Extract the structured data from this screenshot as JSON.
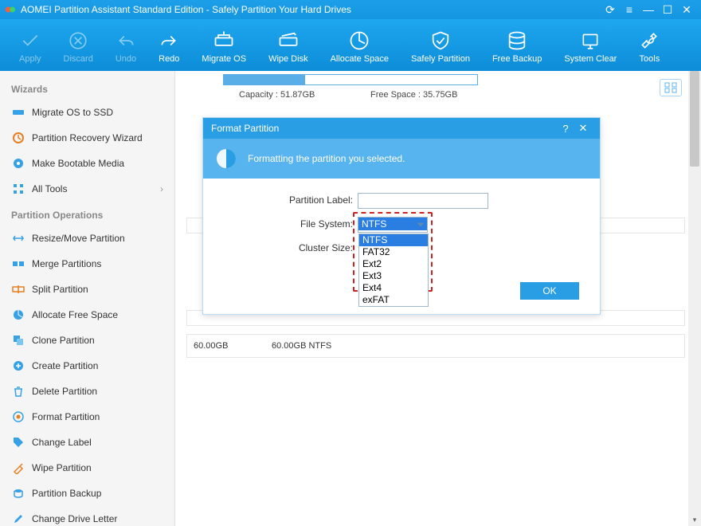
{
  "window": {
    "title": "AOMEI Partition Assistant Standard Edition - Safely Partition Your Hard Drives"
  },
  "toolbar": [
    {
      "label": "Apply",
      "disabled": true
    },
    {
      "label": "Discard",
      "disabled": true
    },
    {
      "label": "Undo",
      "disabled": true
    },
    {
      "label": "Redo"
    },
    {
      "label": "Migrate OS"
    },
    {
      "label": "Wipe Disk"
    },
    {
      "label": "Allocate Space"
    },
    {
      "label": "Safely Partition"
    },
    {
      "label": "Free Backup"
    },
    {
      "label": "System Clear"
    },
    {
      "label": "Tools"
    }
  ],
  "sidebar": {
    "wizards_header": "Wizards",
    "wizards": [
      {
        "label": "Migrate OS to SSD"
      },
      {
        "label": "Partition Recovery Wizard"
      },
      {
        "label": "Make Bootable Media"
      },
      {
        "label": "All Tools",
        "chevron": true
      }
    ],
    "ops_header": "Partition Operations",
    "ops": [
      {
        "label": "Resize/Move Partition"
      },
      {
        "label": "Merge Partitions"
      },
      {
        "label": "Split Partition"
      },
      {
        "label": "Allocate Free Space"
      },
      {
        "label": "Clone Partition"
      },
      {
        "label": "Create Partition"
      },
      {
        "label": "Delete Partition"
      },
      {
        "label": "Format Partition"
      },
      {
        "label": "Change Label"
      },
      {
        "label": "Wipe Partition"
      },
      {
        "label": "Partition Backup"
      },
      {
        "label": "Change Drive Letter"
      }
    ]
  },
  "main": {
    "capacity_label": "Capacity : 51.87GB",
    "free_label": "Free Space : 35.75GB",
    "row_size": "60.00GB",
    "row_desc": "60.00GB NTFS"
  },
  "dialog": {
    "title": "Format Partition",
    "banner": "Formatting the partition you selected.",
    "label_partition": "Partition Label:",
    "label_fs": "File System:",
    "label_cluster": "Cluster Size:",
    "partition_value": "",
    "fs_selected": "NTFS",
    "fs_options": [
      "NTFS",
      "FAT32",
      "Ext2",
      "Ext3",
      "Ext4",
      "exFAT"
    ],
    "ok": "OK"
  }
}
